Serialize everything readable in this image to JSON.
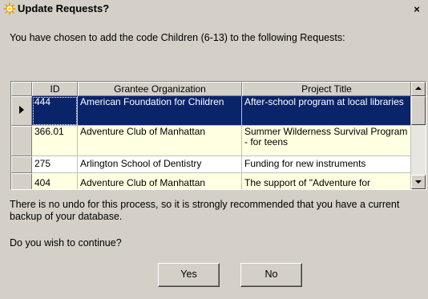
{
  "window": {
    "title": "Update Requests?",
    "close_symbol": "×",
    "icon": "sun-app-icon"
  },
  "message": "You have chosen to add the code Children (6-13) to the following Requests:",
  "grid": {
    "columns": [
      "ID",
      "Grantee Organization",
      "Project Title"
    ],
    "rows": [
      {
        "id": "444",
        "org": "American Foundation for Children",
        "title": "After-school program at local libraries",
        "state": "selected"
      },
      {
        "id": "366.01",
        "org": "Adventure Club of Manhattan",
        "title": "Summer Wilderness Survival Program - for teens",
        "state": "highlight"
      },
      {
        "id": "275",
        "org": "Arlington School of Dentistry",
        "title": "Funding for new instruments",
        "state": "normal"
      },
      {
        "id": "404",
        "org": "Adventure Club of Manhattan",
        "title": "The support of \"Adventure for",
        "state": "normal"
      }
    ]
  },
  "warning": "There is no undo for this process, so it is strongly recommended that you have a current backup of your database.",
  "question": "Do you wish to continue?",
  "buttons": {
    "yes": "Yes",
    "no": "No"
  },
  "colors": {
    "selected_row": "#0a246a",
    "highlight_row": "#ffffe1",
    "dialog_bg": "#d4d0c8"
  }
}
